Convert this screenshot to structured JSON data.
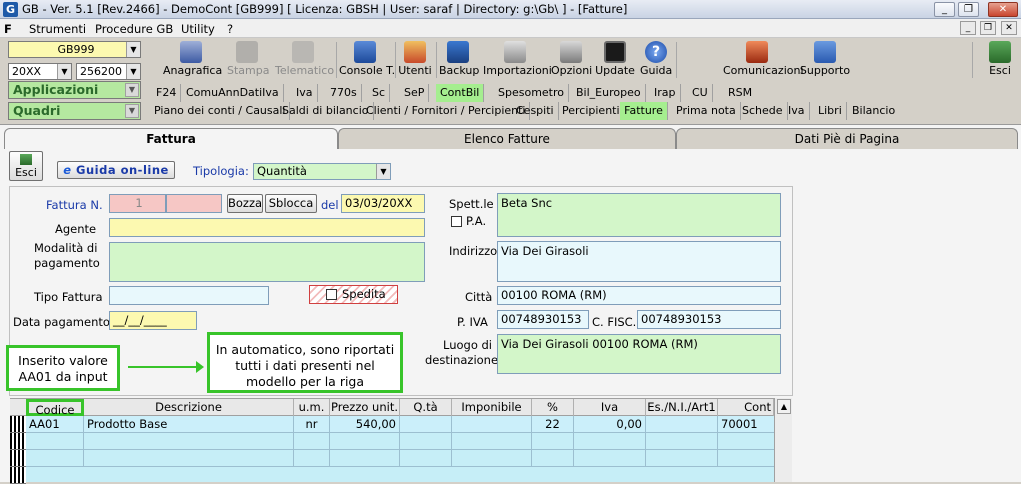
{
  "window": {
    "title": "GB - Ver. 5.1 [Rev.2466] - DemoCont [GB999]   [ Licenza: GBSH | User: saraf | Directory: g:\\Gb\\ ] - [Fatture]",
    "app_icon": "G",
    "minimize": "_",
    "restore": "❐",
    "close": "✕"
  },
  "menu": {
    "items": [
      "Strumenti",
      "Procedure GB",
      "Utility",
      "?"
    ],
    "mdi_controls": [
      "_",
      "❐",
      "✕"
    ]
  },
  "left": {
    "company": "GB999",
    "year": "20XX",
    "code": "256200 -",
    "applicazioni": "Applicazioni",
    "quadri": "Quadri"
  },
  "toolbar": {
    "buttons": [
      {
        "label": "Anagrafica",
        "icon": "anagrafica-icon",
        "enabled": true
      },
      {
        "label": "Stampa",
        "icon": "printer-icon",
        "enabled": false
      },
      {
        "label": "Telematico",
        "icon": "telematico-icon",
        "enabled": false
      },
      {
        "label": "Console T.",
        "icon": "console-icon",
        "enabled": true
      },
      {
        "label": "Utenti",
        "icon": "users-icon",
        "enabled": true
      },
      {
        "label": "Backup",
        "icon": "backup-icon",
        "enabled": true
      },
      {
        "label": "Importazioni",
        "icon": "import-icon",
        "enabled": true
      },
      {
        "label": "Opzioni",
        "icon": "wrench-icon",
        "enabled": true
      },
      {
        "label": "Update",
        "icon": "update-icon",
        "enabled": true
      },
      {
        "label": "Guida",
        "icon": "help-icon",
        "enabled": true
      },
      {
        "label": "Comunicazioni",
        "icon": "comunicazioni-icon",
        "enabled": true
      },
      {
        "label": "Supporto",
        "icon": "supporto-icon",
        "enabled": true
      },
      {
        "label": "Esci",
        "icon": "exit-icon",
        "enabled": true
      }
    ]
  },
  "tabs_row1": [
    "F24",
    "ComuAnnDatiIva",
    "Iva",
    "770s",
    "Sc",
    "SeP",
    "ContBil",
    "Spesometro",
    "Bil_Europeo",
    "Irap",
    "CU",
    "RSM"
  ],
  "tabs_row1_active": "ContBil",
  "tabs_row2": [
    "Piano dei conti / Causali",
    "Saldi di bilancio",
    "Clienti / Fornitori / Percipienti",
    "Cespiti",
    "Percipienti",
    "Fatture",
    "Prima nota",
    "Schede",
    "Iva",
    "Libri",
    "Bilancio"
  ],
  "tabs_row2_active": "Fatture",
  "form_tabs": [
    "Fattura",
    "Elenco Fatture",
    "Dati Piè di Pagina"
  ],
  "form": {
    "esci": "Esci",
    "guida_online": "Guida on-line",
    "tipologia_label": "Tipologia:",
    "tipologia_value": "Quantità",
    "fattura_label": "Fattura N.",
    "fattura_num": "1",
    "bozza": "Bozza",
    "sblocca": "Sblocca",
    "del_label": "del",
    "date": "03/03/20XX",
    "agente_label": "Agente",
    "modalita_label": "Modalità di pagamento",
    "tipo_fattura_label": "Tipo Fattura",
    "spedita_label": "Spedita",
    "data_pagamento_label": "Data pagamento",
    "data_pagamento_value": "__/__/____",
    "spettle_label": "Spett.le",
    "spettle_value": "Beta Snc",
    "pa_label": "P.A.",
    "indirizzo_label": "Indirizzo",
    "indirizzo_value": "Via Dei Girasoli",
    "citta_label": "Città",
    "citta_value": "00100  ROMA (RM)",
    "piva_label": "P. IVA",
    "piva_value": "00748930153",
    "cf_label": "C. FISC.",
    "cf_value": "00748930153",
    "luogo_label": "Luogo di destinazione",
    "luogo_value": "Via Dei Girasoli 00100  ROMA (RM)"
  },
  "annotations": {
    "left_note": "Inserito valore AA01 da input",
    "right_note": "In automatico, sono riportati tutti i dati presenti nel modello per la riga"
  },
  "grid": {
    "columns": [
      "Codice",
      "Descrizione",
      "u.m.",
      "Prezzo unit.",
      "Q.tà",
      "Imponibile",
      "%",
      "Iva",
      "Es./N.I./Art1",
      "Cont"
    ],
    "rows": [
      [
        "AA01",
        "Prodotto Base",
        "nr",
        "540,00",
        "",
        "",
        "22",
        "0,00",
        "",
        "70001"
      ]
    ]
  }
}
